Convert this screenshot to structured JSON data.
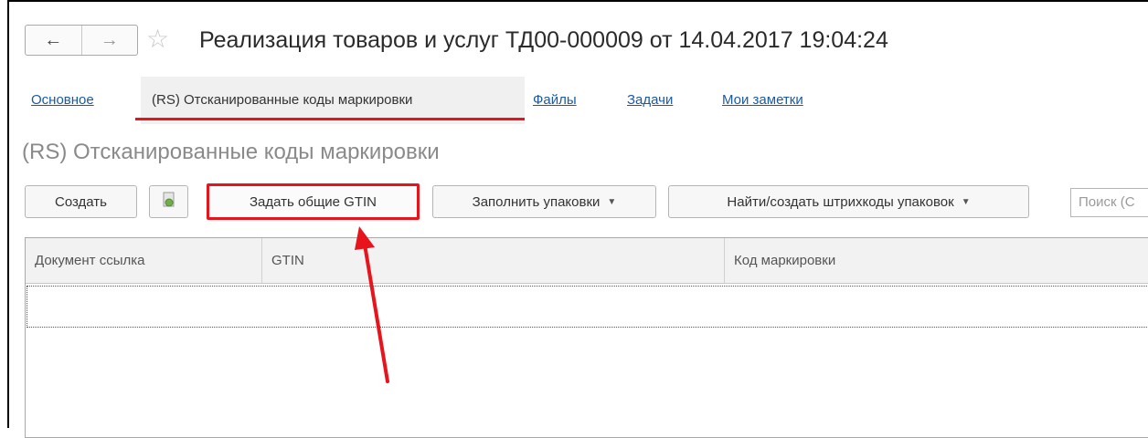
{
  "window": {
    "title": "Реализация товаров и услуг ТД00-000009 от 14.04.2017 19:04:24",
    "back_icon": "←",
    "forward_icon": "→",
    "favorite_icon": "☆"
  },
  "tabs": [
    {
      "label": "Основное",
      "active": false
    },
    {
      "label": "(RS) Отсканированные коды маркировки",
      "active": true
    },
    {
      "label": "Файлы",
      "active": false
    },
    {
      "label": "Задачи",
      "active": false
    },
    {
      "label": "Мои заметки",
      "active": false
    }
  ],
  "section_title": "(RS) Отсканированные коды маркировки",
  "toolbar": {
    "create_label": "Создать",
    "copy_icon": "document-copy-icon",
    "set_gtin_label": "Задать общие GTIN",
    "fill_packages_label": "Заполнить упаковки",
    "find_barcodes_label": "Найти/создать штрихкоды упаковок",
    "search_placeholder": "Поиск (Ctrl+F)",
    "search_visible": "Поиск (С"
  },
  "table": {
    "columns": [
      "Документ ссылка",
      "GTIN",
      "Код маркировки"
    ],
    "rows": []
  },
  "colors": {
    "highlight": "#e8141c",
    "link": "#1a5aa5",
    "tab_active_bg": "#f0f0f0"
  }
}
